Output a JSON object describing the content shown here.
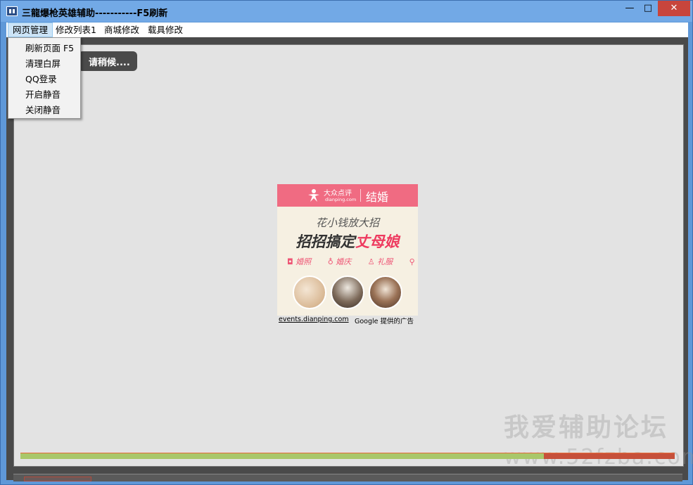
{
  "window": {
    "title": "三龍爆枪英雄辅助-----------F5刷新",
    "minimize_glyph": "—",
    "maximize_glyph": "□",
    "close_glyph": "✕"
  },
  "menubar": {
    "items": [
      {
        "label": "网页管理",
        "active": true
      },
      {
        "label": "修改列表1"
      },
      {
        "label": "商城修改"
      },
      {
        "label": "载具修改"
      }
    ]
  },
  "dropdown": {
    "items": [
      {
        "label": "刷新页面   F5"
      },
      {
        "label": "清理白屏"
      },
      {
        "label": "QQ登录"
      },
      {
        "label": "开启静音"
      },
      {
        "label": "关闭静音"
      }
    ]
  },
  "loading": {
    "text": "请稍候...."
  },
  "ad": {
    "logo_cn": "大众点评",
    "logo_en": "dianping.com",
    "tag": "结婚",
    "subhead": "花小钱放大招",
    "headline_a": "招招搞定",
    "headline_b": "丈母娘",
    "tags": [
      "婚照",
      "婚庆",
      "礼服",
      "场地"
    ],
    "url": "events.dianping.com",
    "google": "Google 提供的广告"
  },
  "progress": {
    "value": 0.2
  },
  "watermark": {
    "text": "我爱辅助论坛",
    "url": "www.52fzba.com"
  },
  "colors": {
    "titlebar": "#72a9e6",
    "close": "#c8453c",
    "ad_pink": "#f06b82",
    "progress": "#a9c76a"
  }
}
